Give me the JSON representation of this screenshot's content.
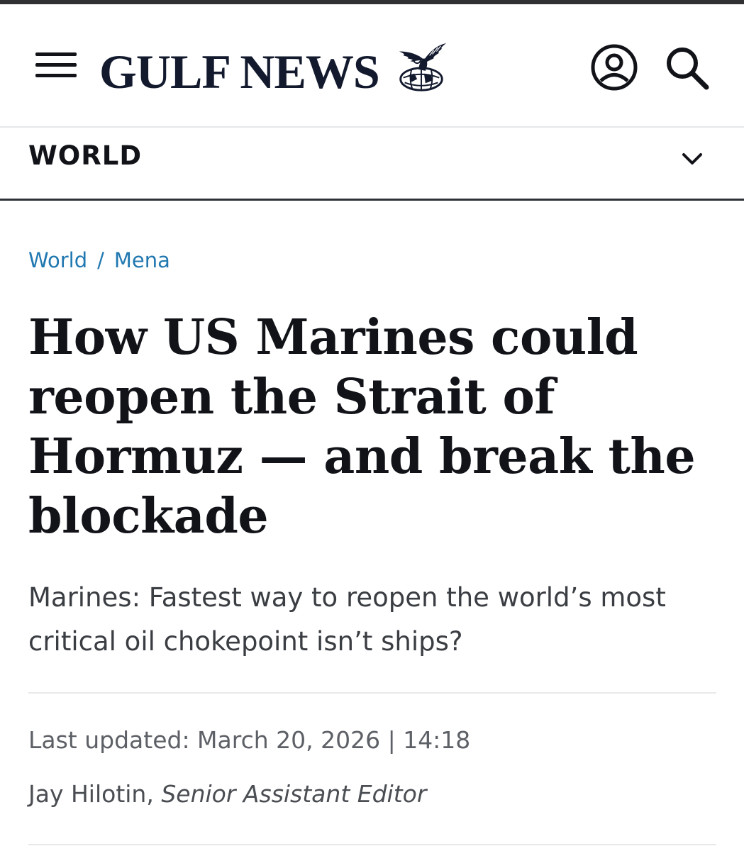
{
  "header": {
    "brand": "GULF NEWS",
    "menu_icon": "hamburger-menu-icon",
    "account_icon": "user-account-icon",
    "search_icon": "search-icon",
    "brand_color": "#131a2e"
  },
  "section_bar": {
    "label": "WORLD",
    "chevron_icon": "chevron-down-icon"
  },
  "breadcrumb": {
    "items": [
      "World",
      "Mena"
    ],
    "separator": "/",
    "link_color": "#2178b0"
  },
  "article": {
    "headline": "How US Marines could reopen the Strait of Hormuz — and break the blockade",
    "subheadline": "Marines: Fastest way to reopen the world’s most critical oil chokepoint isn’t ships?",
    "last_updated": "Last updated: March 20, 2026 | 14:18",
    "author": "Jay Hilotin",
    "author_separator": ",",
    "author_role": "Senior Assistant Editor"
  }
}
